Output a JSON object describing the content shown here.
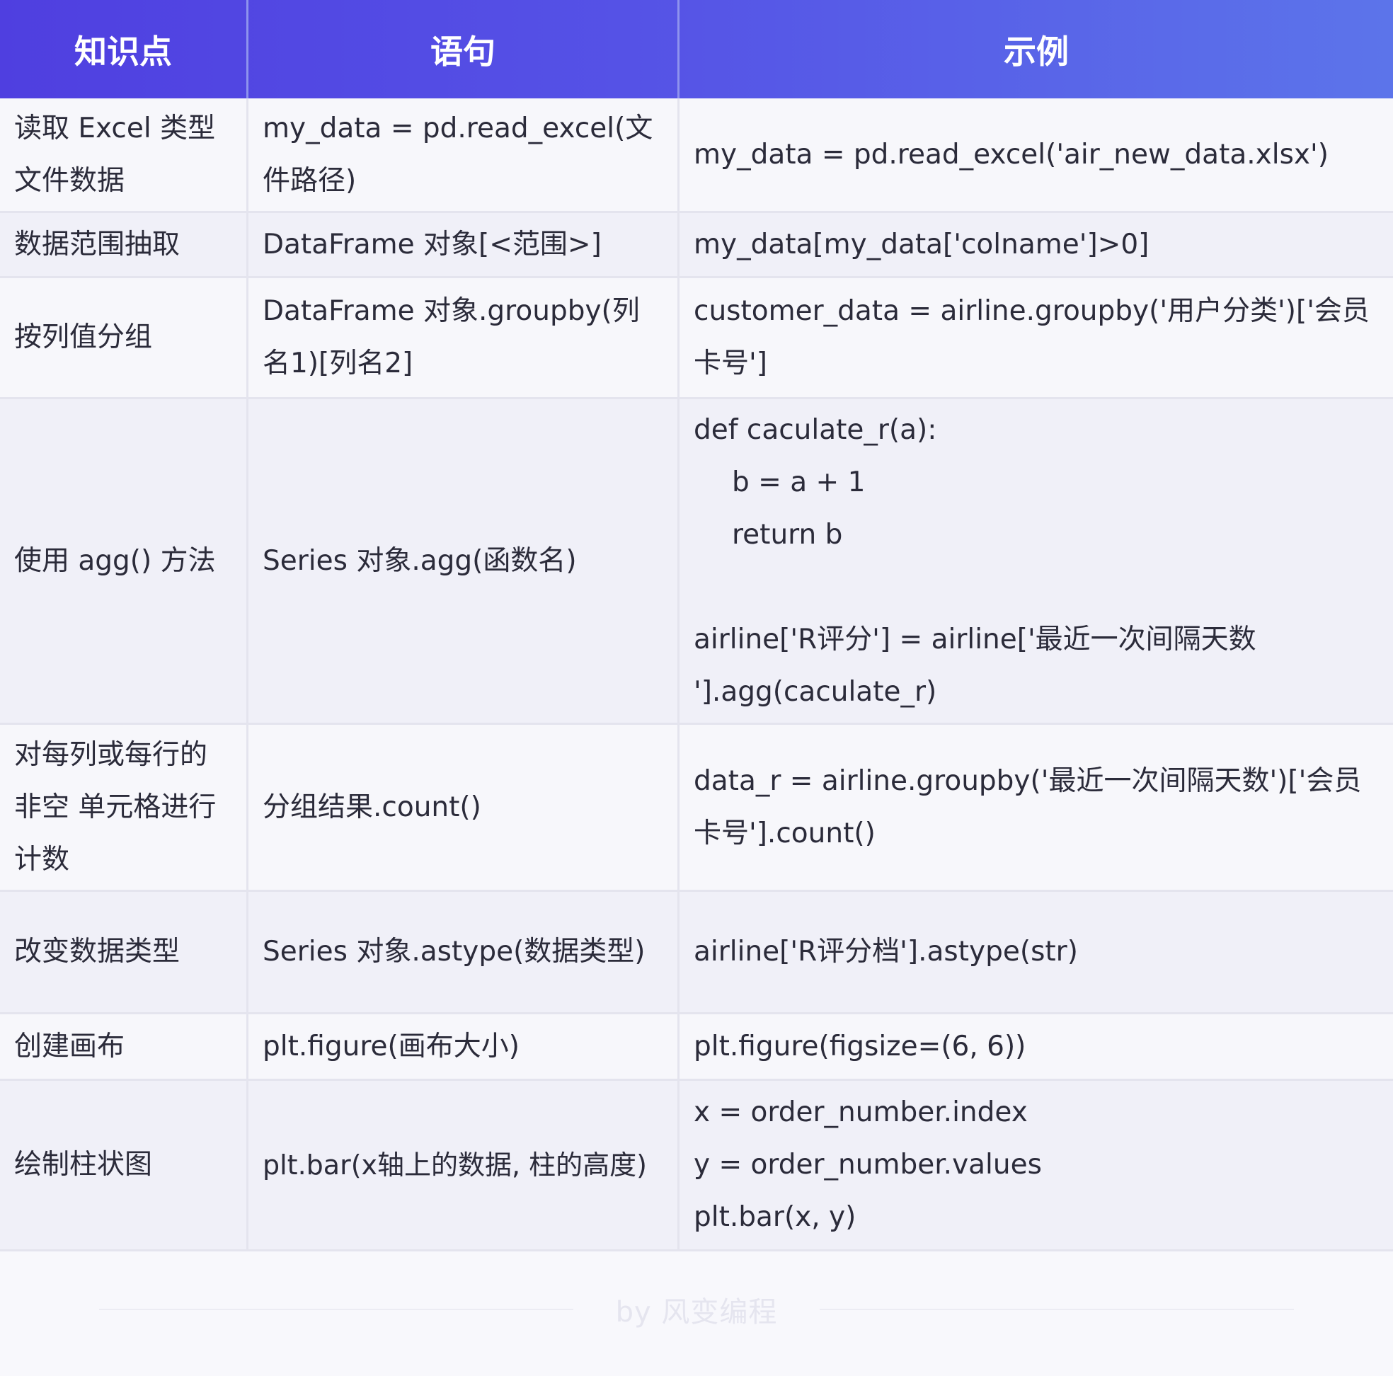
{
  "header": {
    "col1": "知识点",
    "col2": "语句",
    "col3": "示例"
  },
  "rows": [
    {
      "knowledge": [
        "读取 Excel 类型",
        "文件数据"
      ],
      "statement": [
        "my_data = pd.read_excel(文",
        "件路径)"
      ],
      "example": [
        "my_data = pd.read_excel('air_new_data.xlsx')"
      ]
    },
    {
      "knowledge": [
        "数据范围抽取"
      ],
      "statement": [
        "DataFrame 对象[<范围>]"
      ],
      "example": [
        "my_data[my_data['colname']>0]"
      ]
    },
    {
      "knowledge": [
        "按列值分组"
      ],
      "statement": [
        "DataFrame 对象.groupby(列",
        "名1)[列名2]"
      ],
      "example": [
        "customer_data = airline.groupby('用户分类')['会员",
        "卡号']"
      ]
    },
    {
      "knowledge": [
        "使用 agg() 方法"
      ],
      "statement": [
        "Series 对象.agg(函数名)"
      ],
      "example": [
        "def caculate_r(a):",
        "b = a + 1",
        "return b",
        "",
        "airline['R评分'] = airline['最近一次间隔天数",
        "'].agg(caculate_r)"
      ]
    },
    {
      "knowledge": [
        "对每列或每行的",
        "非空 单元格进行",
        "计数"
      ],
      "statement": [
        "分组结果.count()"
      ],
      "example": [
        "data_r = airline.groupby('最近一次间隔天数')['会员",
        "卡号'].count()"
      ]
    },
    {
      "knowledge": [
        "改变数据类型"
      ],
      "statement": [
        "Series 对象.astype(数据类型)"
      ],
      "example": [
        "airline['R评分档'].astype(str)"
      ]
    },
    {
      "knowledge": [
        "创建画布"
      ],
      "statement": [
        "plt.figure(画布大小)"
      ],
      "example": [
        "plt.figure(figsize=(6, 6))"
      ]
    },
    {
      "knowledge": [
        "绘制柱状图"
      ],
      "statement": [
        "plt.bar(x轴上的数据, 柱的高度)"
      ],
      "example": [
        "x = order_number.index",
        "y = order_number.values",
        "plt.bar(x, y)"
      ]
    }
  ],
  "footer": {
    "text": "by 风变编程"
  }
}
